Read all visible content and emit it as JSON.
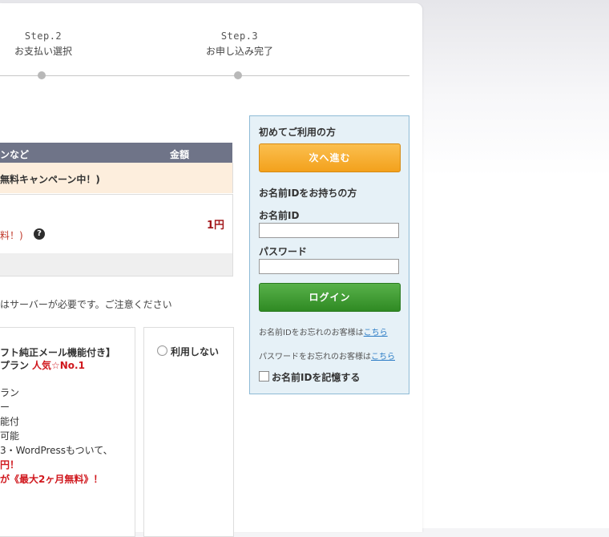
{
  "steps": [
    {
      "num": "Step.2",
      "label": "お支払い選択"
    },
    {
      "num": "Step.3",
      "label": "お申し込み完了"
    }
  ],
  "table": {
    "header_col1": "ンなど",
    "header_col2": "金額",
    "campaign": "無料キャンペーン中！)",
    "price": "1円",
    "price_note": "料！)",
    "help_icon": "?"
  },
  "notice": "はサーバーが必要です。ご注意ください",
  "plan_card": {
    "line1": "フト純正メール機能付き】",
    "line2_a": "プラン",
    "line2_b": "人気☆No.1",
    "line3": "ラン",
    "line4": "ー",
    "line5": "能付",
    "line6": "可能",
    "line7": "3・WordPressもついて、",
    "line8": "円！",
    "line9": "が《最大2ヶ月無料》！"
  },
  "no_use": {
    "label": "利用しない"
  },
  "login": {
    "first_time_title": "初めてご利用の方",
    "next_button": "次へ進む",
    "have_id_title": "お名前IDをお持ちの方",
    "id_label": "お名前ID",
    "id_value": "",
    "password_label": "パスワード",
    "password_value": "",
    "login_button": "ログイン",
    "forgot_id_text": "お名前IDをお忘れのお客様は",
    "forgot_id_link": "こちら",
    "forgot_pw_text": "パスワードをお忘れのお客様は",
    "forgot_pw_link": "こちら",
    "remember_label": "お名前IDを記憶する"
  }
}
